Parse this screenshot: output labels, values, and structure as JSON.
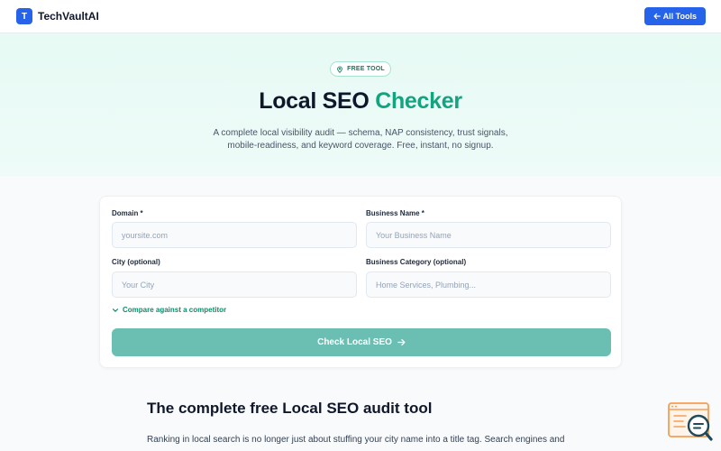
{
  "header": {
    "logo_letter": "T",
    "brand": "TechVaultAI",
    "all_tools_label": "All Tools"
  },
  "hero": {
    "badge": "FREE TOOL",
    "title_main": "Local SEO ",
    "title_accent": "Checker",
    "description_line1": "A complete local visibility audit — schema, NAP consistency, trust signals,",
    "description_line2": "mobile-readiness, and keyword coverage. Free, instant, no signup."
  },
  "form": {
    "domain_label": "Domain *",
    "domain_placeholder": "yoursite.com",
    "business_label": "Business Name *",
    "business_placeholder": "Your Business Name",
    "city_label": "City (optional)",
    "city_placeholder": "Your City",
    "category_label": "Business Category (optional)",
    "category_placeholder": "Home Services, Plumbing...",
    "compare_label": "Compare against a competitor",
    "submit_label": "Check Local SEO"
  },
  "article": {
    "title": "The complete free Local SEO audit tool",
    "intro": "Ranking in local search is no longer just about stuffing your city name into a title tag. Search engines and"
  },
  "colors": {
    "brand_blue": "#2563eb",
    "accent_green": "#13a37f",
    "submit_teal": "#6bbfb2"
  },
  "icons": {
    "badge": "location-pin-icon",
    "back": "arrow-left-icon",
    "compare": "chevron-down-icon",
    "submit": "arrow-right-icon",
    "widget": "search-assistant-icon"
  }
}
